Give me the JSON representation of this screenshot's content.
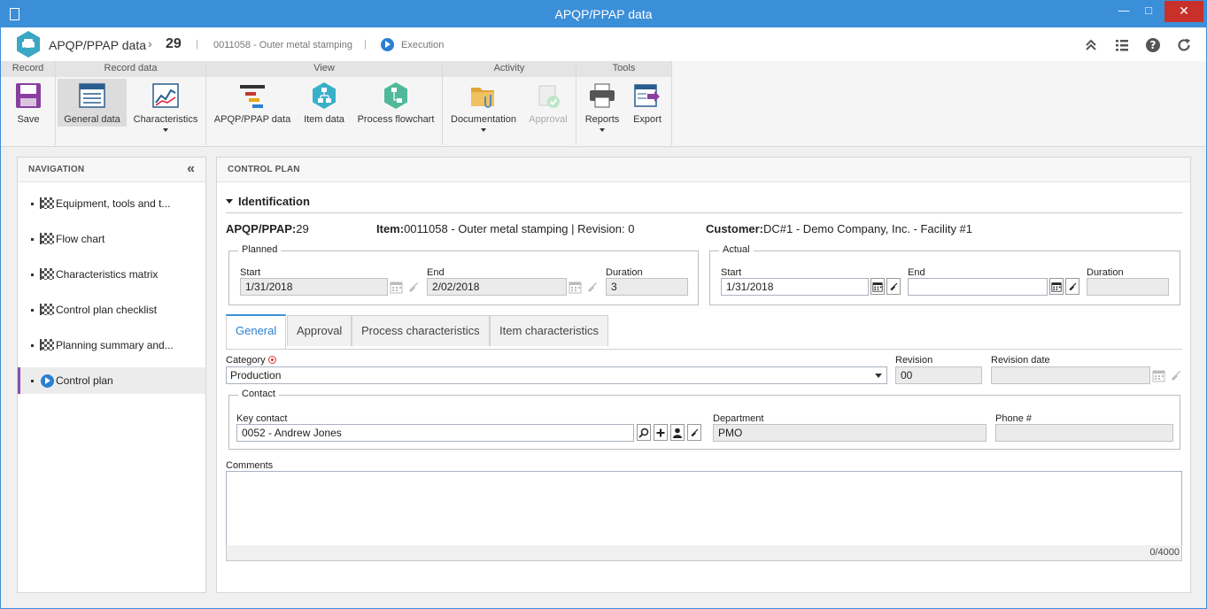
{
  "window": {
    "title": "APQP/PPAP data",
    "minimize": "—",
    "maximize": "□",
    "close": "✕"
  },
  "header": {
    "app_name": "APQP/PPAP data",
    "chevron": "›",
    "record_id": "29",
    "sep": "|",
    "item": "0011058 - Outer metal stamping",
    "stage": "Execution"
  },
  "ribbon": {
    "groups": {
      "record": "Record",
      "record_data": "Record data",
      "view": "View",
      "activity": "Activity",
      "tools": "Tools"
    },
    "buttons": {
      "save": "Save",
      "general_data": "General data",
      "characteristics": "Characteristics",
      "apqp_data": "APQP/PPAP data",
      "item_data": "Item data",
      "process_flowchart": "Process flowchart",
      "documentation": "Documentation",
      "approval": "Approval",
      "reports": "Reports",
      "export": "Export"
    }
  },
  "navigation": {
    "title": "NAVIGATION",
    "collapse": "«",
    "items": [
      {
        "label": "Equipment, tools and t..."
      },
      {
        "label": "Flow chart"
      },
      {
        "label": "Characteristics matrix"
      },
      {
        "label": "Control plan checklist"
      },
      {
        "label": "Planning summary and..."
      },
      {
        "label": "Control plan"
      }
    ]
  },
  "main": {
    "title": "CONTROL PLAN",
    "section": "Identification",
    "apqp_label": "APQP/PPAP:",
    "apqp_value": "29",
    "item_label": "Item:",
    "item_value": "0011058 - Outer metal stamping | Revision: 0",
    "customer_label": "Customer:",
    "customer_value": "DC#1 - Demo Company, Inc. - Facility #1",
    "planned": {
      "legend": "Planned",
      "start_label": "Start",
      "start": "1/31/2018",
      "end_label": "End",
      "end": "2/02/2018",
      "duration_label": "Duration",
      "duration": "3"
    },
    "actual": {
      "legend": "Actual",
      "start_label": "Start",
      "start": "1/31/2018",
      "end_label": "End",
      "end": "",
      "duration_label": "Duration",
      "duration": ""
    },
    "tabs": [
      "General",
      "Approval",
      "Process characteristics",
      "Item characteristics"
    ],
    "general": {
      "category_label": "Category",
      "category": "Production",
      "revision_label": "Revision",
      "revision": "00",
      "revision_date_label": "Revision date",
      "revision_date": "",
      "contact_legend": "Contact",
      "key_contact_label": "Key contact",
      "key_contact": "0052 - Andrew Jones",
      "department_label": "Department",
      "department": "PMO",
      "phone_label": "Phone #",
      "phone": "",
      "comments_label": "Comments",
      "comments": "",
      "counter": "0/4000"
    }
  },
  "colors": {
    "accent": "#3b8fd8",
    "active_nav": "#8a4fa8",
    "close_btn": "#c7312a"
  }
}
